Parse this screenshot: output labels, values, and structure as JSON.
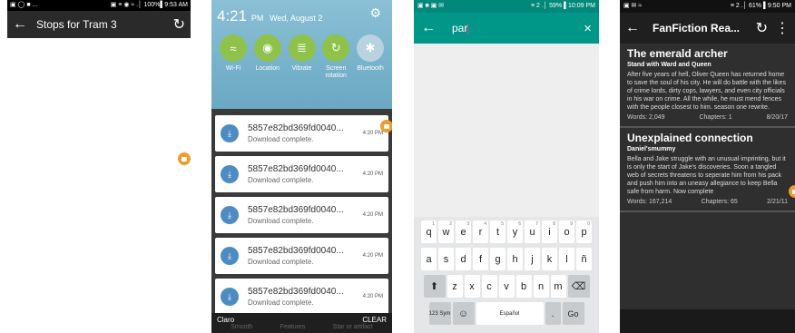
{
  "panel1": {
    "status": {
      "left": "▣ ◯ ■ ...",
      "right": "▣ ≡ ◉ ≈ .│ 100%▌9:53 AM"
    },
    "title": "Stops for Tram 3",
    "back_glyph": "←",
    "refresh_glyph": "↻"
  },
  "panel2": {
    "time": "4:21",
    "ampm": "PM",
    "date": "Wed, August 2",
    "gear_glyph": "⚙",
    "toggles": [
      {
        "label": "Wi-Fi",
        "glyph": "≈",
        "on": true
      },
      {
        "label": "Location",
        "glyph": "◉",
        "on": true
      },
      {
        "label": "Vibrate",
        "glyph": "≣",
        "on": true
      },
      {
        "label": "Screen rotation",
        "glyph": "↻",
        "on": true
      },
      {
        "label": "Bluetooth",
        "glyph": "✱",
        "on": false
      }
    ],
    "notifications": [
      {
        "file": "5857e82bd369fd0040...",
        "sub": "Download complete.",
        "time": "4:20 PM"
      },
      {
        "file": "5857e82bd369fd0040...",
        "sub": "Download complete.",
        "time": "4:20 PM"
      },
      {
        "file": "5857e82bd369fd0040...",
        "sub": "Download complete.",
        "time": "4:20 PM"
      },
      {
        "file": "5857e82bd369fd0040...",
        "sub": "Download complete.",
        "time": "4:20 PM"
      },
      {
        "file": "5857e82bd369fd0040...",
        "sub": "Download complete.",
        "time": "4:20 PM"
      }
    ],
    "carrier": "Claro",
    "clear": "CLEAR",
    "faint_tabs": [
      "Smooth",
      "Features",
      "Star or artifact"
    ]
  },
  "panel3": {
    "status": {
      "left": "▣ ■ ▣ ✉",
      "right": "≡ 2 .│ 59% ▌10:09 PM"
    },
    "back_glyph": "←",
    "query": "par",
    "close_glyph": "×",
    "keyboard": {
      "row1": [
        {
          "k": "q",
          "n": "1"
        },
        {
          "k": "w",
          "n": "2"
        },
        {
          "k": "e",
          "n": "3"
        },
        {
          "k": "r",
          "n": "4"
        },
        {
          "k": "t",
          "n": "5"
        },
        {
          "k": "y",
          "n": "6"
        },
        {
          "k": "u",
          "n": "7"
        },
        {
          "k": "i",
          "n": "8"
        },
        {
          "k": "o",
          "n": "9"
        },
        {
          "k": "p",
          "n": "0"
        }
      ],
      "row2": [
        "a",
        "s",
        "d",
        "f",
        "g",
        "h",
        "j",
        "k",
        "l",
        "ñ"
      ],
      "row3": [
        "z",
        "x",
        "c",
        "v",
        "b",
        "n",
        "m"
      ],
      "shift_glyph": "⬆",
      "backspace_glyph": "⌫",
      "sym": "123 Sym",
      "emoji_glyph": "☺",
      "space_label": "Español",
      "period": ".",
      "go": "Go"
    }
  },
  "panel4": {
    "status": {
      "left": "▣ ✉ ≈",
      "right": "≡ 2 .│ 61% ▌9:50 PM"
    },
    "back_glyph": "←",
    "title": "FanFiction Rea...",
    "refresh_glyph": "↻",
    "menu_glyph": "⋮",
    "stories": [
      {
        "title": "The emerald archer",
        "author": "Stand with Ward and Queen",
        "summary": "After five years of hell, Oliver Queen has returned home to save the soul of his city. He will do battle with the likes of crime lords, dirty cops, lawyers, and even city officials in his war on crime. All the while, he must mend fences with the people closest to him. season one rewrite.",
        "words": "Words: 2,049",
        "chapters": "Chapters: 1",
        "date": "8/20/17"
      },
      {
        "title": "Unexplained connection",
        "author": "Daniel'smummy",
        "summary": "Bella and Jake struggle with an unusual imprinting, but it is only the start of Jake's discoveries. Soon a tangled web of secrets threatens to seperate him from his pack and push him into an uneasy allegiance to keep Bella safe from harm. Now complete",
        "words": "Words: 167,214",
        "chapters": "Chapters: 65",
        "date": "2/21/11"
      }
    ]
  },
  "colors": {
    "accent_orange": "#f39a2c",
    "teal": "#009688",
    "toggle_green": "#8fc24a"
  }
}
